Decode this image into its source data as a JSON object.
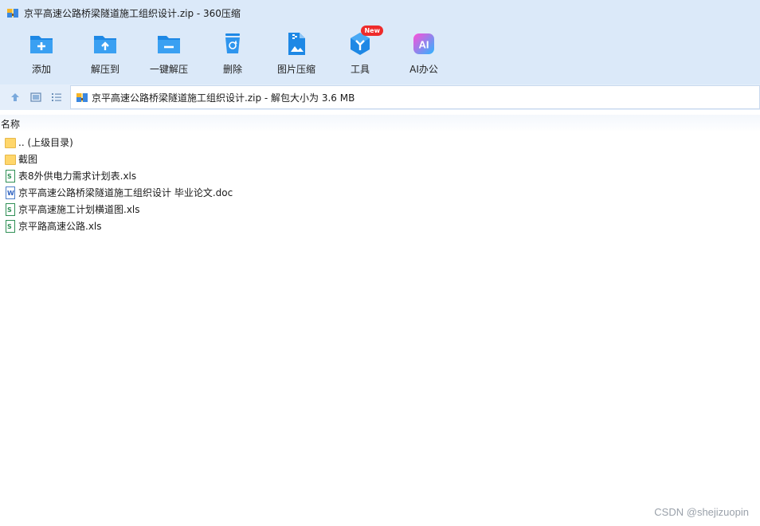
{
  "window": {
    "title": "京平高速公路桥梁隧道施工组织设计.zip - 360压缩"
  },
  "toolbar": {
    "items": [
      {
        "label": "添加",
        "icon": "add-folder-icon"
      },
      {
        "label": "解压到",
        "icon": "extract-to-icon"
      },
      {
        "label": "一键解压",
        "icon": "one-click-extract-icon"
      },
      {
        "label": "删除",
        "icon": "recycle-bin-icon"
      },
      {
        "label": "图片压缩",
        "icon": "image-compress-icon"
      },
      {
        "label": "工具",
        "icon": "tools-icon",
        "badge": "New"
      },
      {
        "label": "AI办公",
        "icon": "ai-office-icon",
        "icon_text": "AI"
      }
    ]
  },
  "nav": {
    "address": "京平高速公路桥梁隧道施工组织设计.zip - 解包大小为 3.6 MB"
  },
  "list": {
    "column_name": "名称",
    "rows": [
      {
        "name": ".. (上级目录)",
        "type": "folder"
      },
      {
        "name": "截图",
        "type": "folder"
      },
      {
        "name": "表8外供电力需求计划表.xls",
        "type": "xls"
      },
      {
        "name": "京平高速公路桥梁隧道施工组织设计 毕业论文.doc",
        "type": "doc"
      },
      {
        "name": "京平高速施工计划横道图.xls",
        "type": "xls"
      },
      {
        "name": "京平路高速公路.xls",
        "type": "xls"
      }
    ]
  },
  "watermark": "CSDN @shejizuopin",
  "colors": {
    "chrome_bg": "#dbe9f9",
    "icon_blue": "#1e88e5",
    "badge_red": "#ee2b2b",
    "ai_gradient_start": "#ff4fd8",
    "ai_gradient_end": "#2bb5ff"
  }
}
